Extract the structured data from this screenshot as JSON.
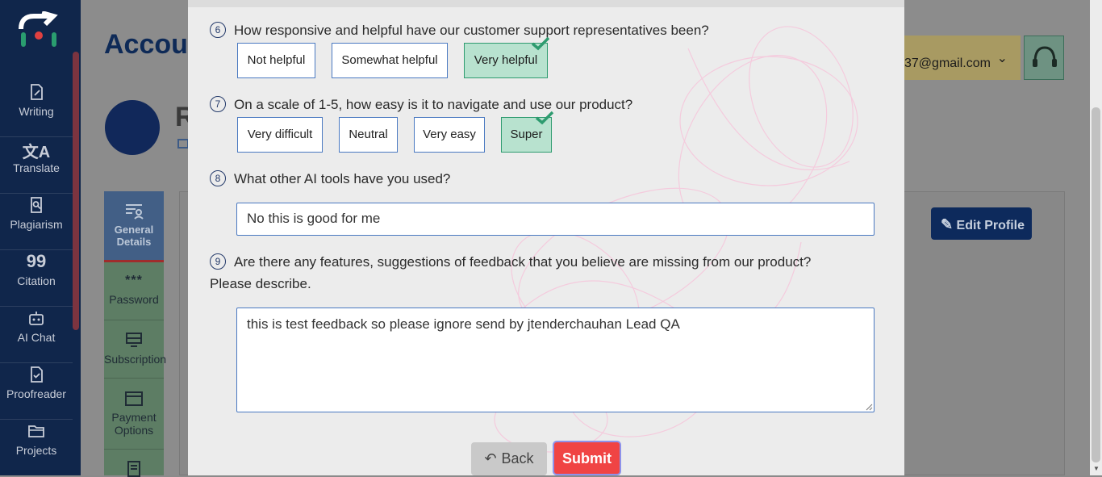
{
  "sidebar": {
    "items": [
      {
        "label": "Writing",
        "icon": "writing-icon"
      },
      {
        "label": "Translate",
        "icon": "translate-icon"
      },
      {
        "label": "Plagiarism",
        "icon": "plagiarism-icon"
      },
      {
        "label": "Citation",
        "icon": "citation-icon"
      },
      {
        "label": "AI Chat",
        "icon": "robot-icon"
      },
      {
        "label": "Proofreader",
        "icon": "proofreader-icon"
      },
      {
        "label": "Projects",
        "icon": "folder-icon"
      }
    ]
  },
  "header": {
    "title_fragment": "Accou",
    "email_fragment": "37@gmail.com",
    "name_fragment": "R"
  },
  "account_tabs": [
    {
      "label": "General Details",
      "icon": "user-details-icon"
    },
    {
      "label": "Password",
      "icon": "password-icon"
    },
    {
      "label": "Subscription",
      "icon": "subscription-icon"
    },
    {
      "label": "Payment Options",
      "icon": "card-icon"
    },
    {
      "label": "",
      "icon": "document-icon"
    }
  ],
  "edit_profile_label": "Edit Profile",
  "survey": {
    "q6": {
      "num": "6",
      "text": "How responsive and helpful have our customer support representatives been?",
      "options": [
        "Not helpful",
        "Somewhat helpful",
        "Very helpful"
      ],
      "selected": "Very helpful"
    },
    "q7": {
      "num": "7",
      "text": "On a scale of 1-5, how easy is it to navigate and use our product?",
      "options": [
        "Very difficult",
        "Neutral",
        "Very easy",
        "Super"
      ],
      "selected": "Super"
    },
    "q8": {
      "num": "8",
      "text": "What other AI tools have you used?",
      "value": "No this is good for me"
    },
    "q9": {
      "num": "9",
      "text_line1": "Are there any features, suggestions of feedback that you believe are missing from our product?",
      "text_line2": "Please describe.",
      "value": "this is test feedback so please ignore send by jtenderchauhan Lead QA"
    },
    "back_label": "Back",
    "submit_label": "Submit"
  },
  "colors": {
    "sidebar_bg": "#10264b",
    "selected_option_bg": "#b8e2cf",
    "check_color": "#2e9b6f",
    "submit_bg": "#f04444",
    "input_border": "#4a79c1"
  }
}
